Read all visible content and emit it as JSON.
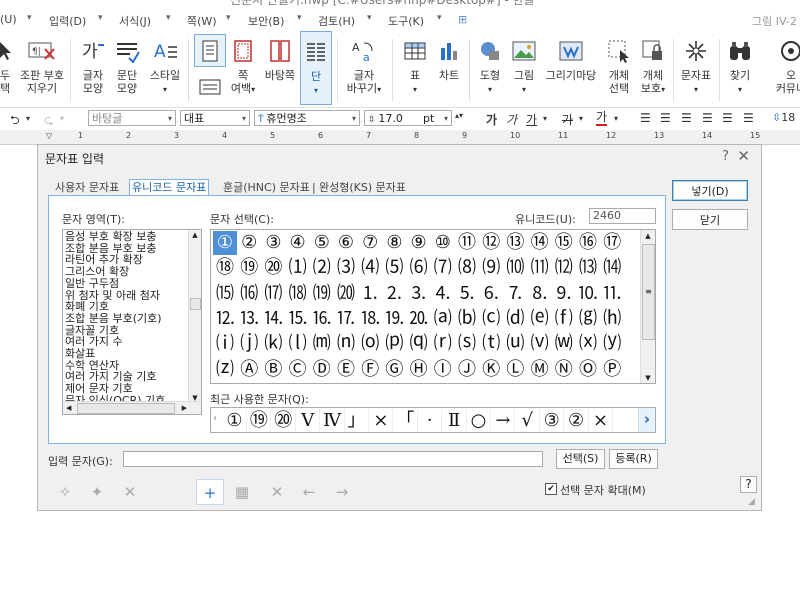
{
  "window": {
    "title": "신문지 만들기.hwp [C:#Users#nhp#Desktop#] - 한글"
  },
  "menubar": {
    "items": [
      "(U)",
      "입력(D)",
      "서식(J)",
      "쪽(W)",
      "보안(B)",
      "검토(H)",
      "도구(K)"
    ],
    "right_text": "그림 IV-2"
  },
  "ribbon": {
    "items": [
      {
        "label": "두\n택",
        "icon": "cursor-icon"
      },
      {
        "label": "조판 부호\n지우기",
        "icon": "erase-marks-icon"
      },
      {
        "label": "글자\n모양",
        "icon": "char-shape-icon"
      },
      {
        "label": "문단\n모양",
        "icon": "para-shape-icon"
      },
      {
        "label": "스타일",
        "icon": "style-icon"
      },
      {
        "label": "",
        "icon": "page-icon"
      },
      {
        "label": "쪽\n여백",
        "icon": "margin-icon"
      },
      {
        "label": "바탕쪽",
        "icon": "master-page-icon"
      },
      {
        "label": "단",
        "icon": "columns-icon"
      },
      {
        "label": "글자\n바꾸기",
        "icon": "convert-char-icon"
      },
      {
        "label": "표",
        "icon": "table-icon"
      },
      {
        "label": "차트",
        "icon": "chart-icon"
      },
      {
        "label": "도형",
        "icon": "shape-icon"
      },
      {
        "label": "그림",
        "icon": "picture-icon"
      },
      {
        "label": "그리기마당",
        "icon": "clipart-icon"
      },
      {
        "label": "개체\n선택",
        "icon": "object-select-icon"
      },
      {
        "label": "개체\n보호",
        "icon": "object-protect-icon"
      },
      {
        "label": "문자표",
        "icon": "symbol-icon"
      },
      {
        "label": "찾기",
        "icon": "find-icon"
      },
      {
        "label": "오\n커뮤니",
        "icon": "community-icon"
      }
    ]
  },
  "formatbar": {
    "style": "바탕글",
    "lang": "대표",
    "font": "휴먼명조",
    "size": "17.0",
    "unit": "pt",
    "bold": "가",
    "italic": "가",
    "underline": "가",
    "strike": "가",
    "color": "가",
    "right_num": "18"
  },
  "ruler": {
    "numbers": [
      "1",
      "2",
      "3",
      "4",
      "5",
      "6",
      "7",
      "8",
      "9",
      "10",
      "11",
      "12",
      "13",
      "14",
      "15"
    ]
  },
  "dialog": {
    "title": "문자표 입력",
    "help": "?",
    "close": "✕",
    "tabs": [
      "사용자 문자표",
      "유니코드 문자표",
      "훈글(HNC) 문자표",
      "완성형(KS) 문자표"
    ],
    "tab_sep": "|",
    "area_label": "문자 영역(T):",
    "areas": [
      "음성 부호 확장 보충",
      "조합 분음 부호 보충",
      "라틴어 추가 확장",
      "그리스어 확장",
      "일반 구두점",
      "위 첨자 및 아래 첨자",
      "화폐 기호",
      "조합 분음 부호(기호)",
      "글자꼴 기호",
      "여러 가지 수",
      "화살표",
      "수학 연산자",
      "여러 가지 기술 기호",
      "제어 문자 기호",
      "문자 인식(OCR) 기호",
      "괄호 문자"
    ],
    "selected_area": "괄호 문자",
    "char_label": "문자 선택(C):",
    "unicode_label": "유니코드(U):",
    "unicode_value": "2460",
    "chars": [
      [
        "①",
        "②",
        "③",
        "④",
        "⑤",
        "⑥",
        "⑦",
        "⑧",
        "⑨",
        "⑩",
        "⑪",
        "⑫",
        "⑬",
        "⑭",
        "⑮",
        "⑯",
        "⑰"
      ],
      [
        "⑱",
        "⑲",
        "⑳",
        "⑴",
        "⑵",
        "⑶",
        "⑷",
        "⑸",
        "⑹",
        "⑺",
        "⑻",
        "⑼",
        "⑽",
        "⑾",
        "⑿",
        "⒀",
        "⒁"
      ],
      [
        "⒂",
        "⒃",
        "⒄",
        "⒅",
        "⒆",
        "⒇",
        "⒈",
        "⒉",
        "⒊",
        "⒋",
        "⒌",
        "⒍",
        "⒎",
        "⒏",
        "⒐",
        "⒑",
        "⒒"
      ],
      [
        "⒓",
        "⒔",
        "⒕",
        "⒖",
        "⒗",
        "⒘",
        "⒙",
        "⒚",
        "⒛",
        "⒜",
        "⒝",
        "⒞",
        "⒟",
        "⒠",
        "⒡",
        "⒢",
        "⒣"
      ],
      [
        "⒤",
        "⒥",
        "⒦",
        "⒧",
        "⒨",
        "⒩",
        "⒪",
        "⒫",
        "⒬",
        "⒭",
        "⒮",
        "⒯",
        "⒰",
        "⒱",
        "⒲",
        "⒳",
        "⒴"
      ],
      [
        "⒵",
        "Ⓐ",
        "Ⓑ",
        "Ⓒ",
        "Ⓓ",
        "Ⓔ",
        "Ⓕ",
        "Ⓖ",
        "Ⓗ",
        "Ⓘ",
        "Ⓙ",
        "Ⓚ",
        "Ⓛ",
        "Ⓜ",
        "Ⓝ",
        "Ⓞ",
        "Ⓟ"
      ]
    ],
    "recent_label": "최근 사용한 문자(Q):",
    "recent": [
      "①",
      "⑲",
      "⑳",
      "Ⅴ",
      "Ⅳ",
      "」",
      "×",
      "「",
      "·",
      "Ⅱ",
      "○",
      "→",
      "√",
      "③",
      "②",
      "×"
    ],
    "insert_button": "넣기(D)",
    "close_button": "닫기",
    "input_label": "입력 문자(G):",
    "input_value": "",
    "select_button": "선택(S)",
    "register_button": "등록(R)",
    "enlarge_label": "선택 문자 확대(M)",
    "enlarge_checked": true,
    "help_button": "?"
  }
}
